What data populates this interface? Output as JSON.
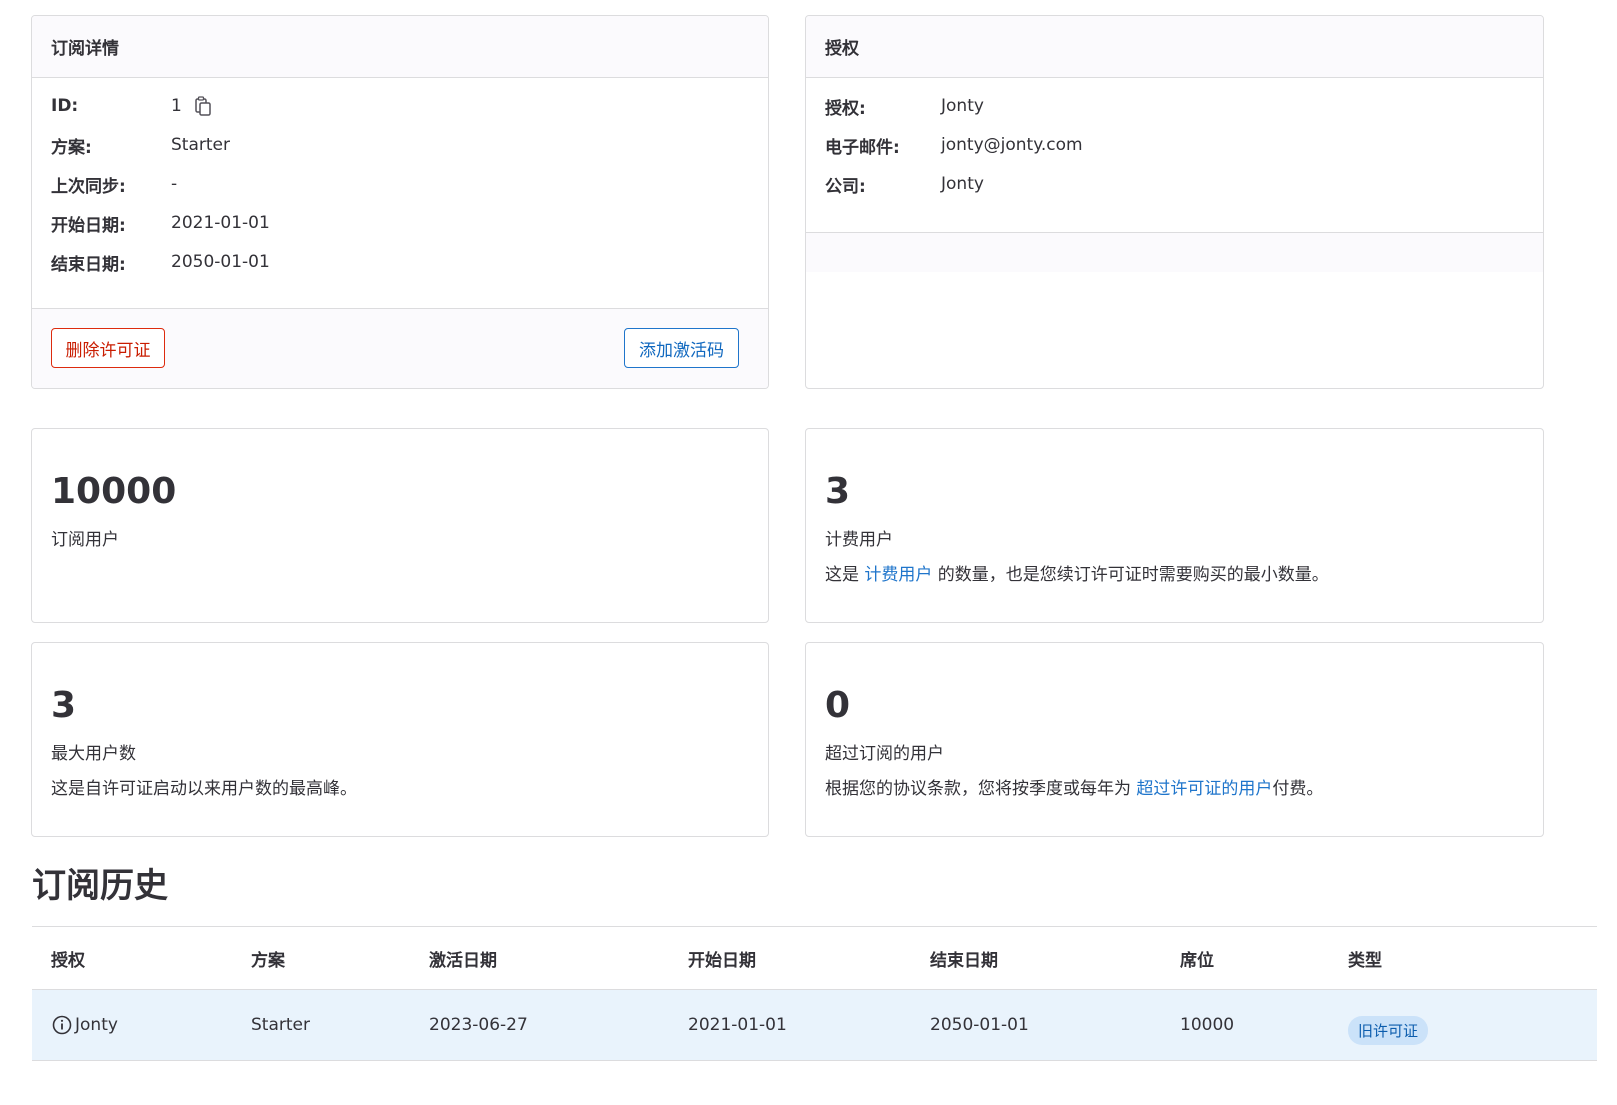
{
  "subscription_details": {
    "title": "订阅详情",
    "rows": [
      {
        "label": "ID:",
        "value": "1"
      },
      {
        "label": "方案:",
        "value": "Starter"
      },
      {
        "label": "上次同步:",
        "value": "-"
      },
      {
        "label": "开始日期:",
        "value": "2021-01-01"
      },
      {
        "label": "结束日期:",
        "value": "2050-01-01"
      }
    ],
    "delete_button": "删除许可证",
    "add_code_button": "添加激活码"
  },
  "license": {
    "title": "授权",
    "rows": [
      {
        "label": "授权:",
        "value": "Jonty"
      },
      {
        "label": "电子邮件:",
        "value": "jonty@jonty.com"
      },
      {
        "label": "公司:",
        "value": "Jonty"
      }
    ]
  },
  "stats": {
    "subscribed_users": {
      "number": "10000",
      "label": "订阅用户"
    },
    "billable_users": {
      "number": "3",
      "label": "计费用户",
      "desc_prefix": "这是 ",
      "desc_link": "计费用户",
      "desc_suffix": " 的数量，也是您续订许可证时需要购买的最小数量。"
    },
    "max_users": {
      "number": "3",
      "label": "最大用户数",
      "desc": "这是自许可证启动以来用户数的最高峰。"
    },
    "overage_users": {
      "number": "0",
      "label": "超过订阅的用户",
      "desc_prefix": "根据您的协议条款，您将按季度或每年为 ",
      "desc_link": "超过许可证的用户",
      "desc_suffix": "付费。"
    }
  },
  "history": {
    "title": "订阅历史",
    "columns": [
      "授权",
      "方案",
      "激活日期",
      "开始日期",
      "结束日期",
      "席位",
      "类型"
    ],
    "rows": [
      {
        "licensee": "Jonty",
        "plan": "Starter",
        "activated": "2023-06-27",
        "start": "2021-01-01",
        "end": "2050-01-01",
        "seats": "10000",
        "type": "旧许可证"
      }
    ]
  },
  "colors": {
    "link": "#1f75cb",
    "danger": "#dd2b0e",
    "row_highlight": "#e9f3fc",
    "badge_bg": "#cbe2f9"
  }
}
